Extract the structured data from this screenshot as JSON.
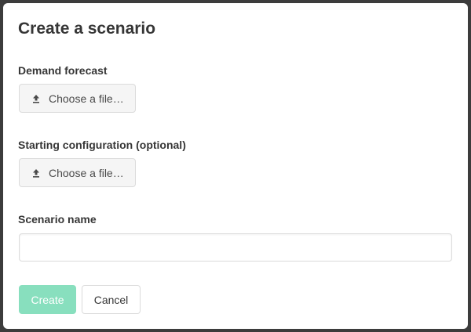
{
  "dialog": {
    "title": "Create a scenario",
    "demand_forecast": {
      "label": "Demand forecast",
      "button_label": "Choose a file…",
      "icon": "upload-icon"
    },
    "starting_configuration": {
      "label": "Starting configuration (optional)",
      "button_label": "Choose a file…",
      "icon": "upload-icon"
    },
    "scenario_name": {
      "label": "Scenario name",
      "value": "",
      "placeholder": ""
    },
    "actions": {
      "create_label": "Create",
      "create_disabled": true,
      "cancel_label": "Cancel"
    }
  },
  "colors": {
    "primary_disabled": "#88dfbe",
    "text": "#363636",
    "border": "#dbdbdb",
    "backdrop": "#3c3c3c"
  }
}
